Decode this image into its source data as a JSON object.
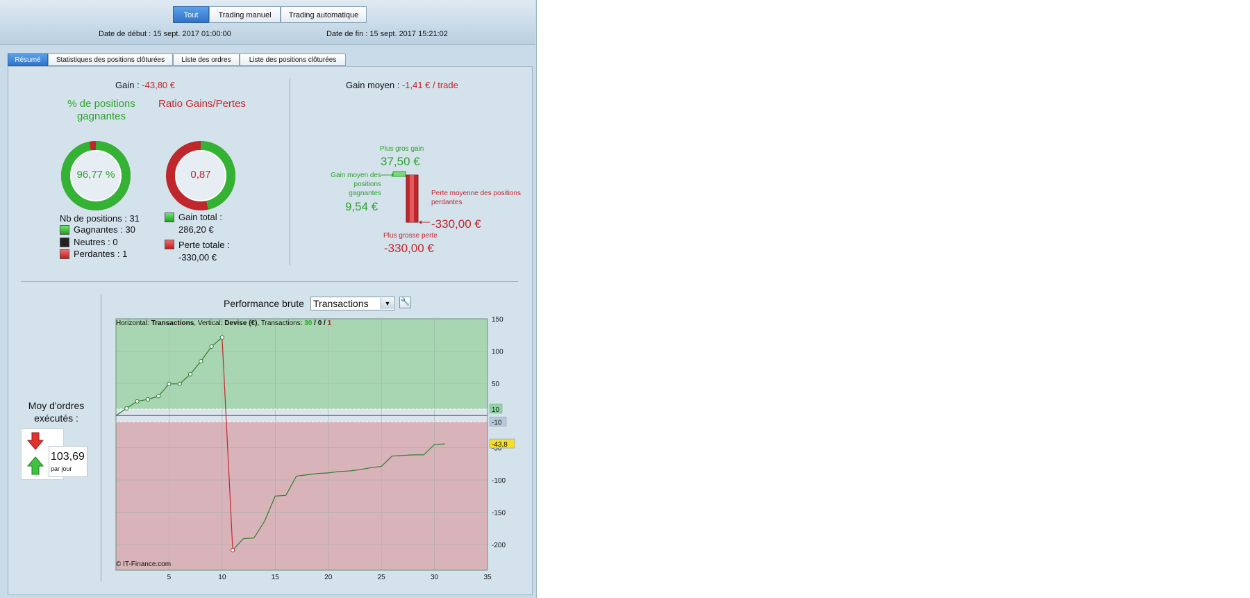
{
  "filter": {
    "tout": "Tout",
    "manuel": "Trading manuel",
    "auto": "Trading automatique"
  },
  "dates": {
    "start": "Date de début :  15 sept. 2017 01:00:00",
    "end": "Date de fin :  15 sept. 2017 15:21:02"
  },
  "tabs": [
    "Résumé",
    "Statistiques des positions clôturées",
    "Liste des ordres",
    "Liste des positions clôturées"
  ],
  "summary": {
    "gain_label": "Gain : ",
    "gain_value": "-43,80 €",
    "pct_title": "% de positions gagnantes",
    "pct_value": "96,77 %",
    "pct_fraction": 0.9677,
    "ratio_title": "Ratio Gains/Pertes",
    "ratio_value": "0,87",
    "ratio_win_fraction": 0.4644,
    "nb_positions": "Nb de positions : 31",
    "gagnantes": "Gagnantes : 30",
    "neutres": "Neutres : 0",
    "perdantes": "Perdantes : 1",
    "gain_total_label": "Gain total :",
    "gain_total_value": "286,20 €",
    "perte_totale_label": "Perte totale :",
    "perte_totale_value": "-330,00 €",
    "colors": {
      "win": "#2ea12e",
      "loss": "#c0272d"
    }
  },
  "avg": {
    "label": "Gain moyen : ",
    "value": "-1,41 € / trade",
    "plus_gros_gain_label": "Plus gros gain",
    "plus_gros_gain_value": "37,50 €",
    "gain_moyen_label": "Gain moyen des positions gagnantes",
    "gain_moyen_value": "9,54 €",
    "perte_moyenne_label": "Perte moyenne des positions perdantes",
    "perte_moyenne_value": "-330,00 €",
    "plus_grosse_perte_label": "Plus grosse perte",
    "plus_grosse_perte_value": "-330,00 €"
  },
  "orders": {
    "label": "Moy d'ordres exécutés :",
    "value": "103,69",
    "unit": "par jour"
  },
  "performance": {
    "title": "Performance brute",
    "select_value": "Transactions",
    "legend_h": "Horizontal: ",
    "legend_h_val": "Transactions",
    "legend_v": ", Vertical: ",
    "legend_v_val": "Devise (€)",
    "legend_t": ", Transactions: ",
    "legend_t_win": "30",
    "legend_t_sep1": " / ",
    "legend_t_neu": "0",
    "legend_t_sep2": " / ",
    "legend_t_loss": "1",
    "copyright": "© IT-Finance.com",
    "marker_up": "10",
    "marker_down": "-10",
    "marker_last": "-43,8"
  },
  "chart_data": {
    "type": "line",
    "xlabel": "",
    "ylabel": "",
    "xlim": [
      0,
      35
    ],
    "ylim": [
      -240,
      150
    ],
    "x_ticks": [
      5,
      10,
      15,
      20,
      25,
      30,
      35
    ],
    "y_ticks": [
      150,
      100,
      50,
      0,
      -50,
      -100,
      -150,
      -200
    ],
    "y_tick_labels": [
      "150",
      "100",
      "50",
      "",
      "-50",
      "-100",
      "-150",
      "-200"
    ],
    "bands": {
      "upper": 10,
      "lower": -10
    },
    "series": [
      {
        "x": [
          0,
          1,
          2,
          3,
          4,
          5,
          6,
          7,
          8,
          9,
          10,
          11,
          12,
          13,
          14,
          15,
          16,
          17,
          18,
          19,
          20,
          21,
          22,
          23,
          24,
          25,
          26,
          27,
          28,
          29,
          30,
          31
        ],
        "y": [
          0,
          11,
          22,
          25,
          30,
          49,
          49,
          64,
          84,
          107,
          121,
          -209,
          -191,
          -190,
          -164,
          -125,
          -124,
          -94,
          -92,
          -90,
          -89,
          -87,
          -86,
          -84,
          -81,
          -79,
          -63,
          -62,
          -61,
          -61,
          -45,
          -44
        ]
      }
    ],
    "marked_points": [
      1,
      2,
      3,
      4,
      5,
      6,
      7,
      8,
      9,
      10,
      11
    ]
  }
}
